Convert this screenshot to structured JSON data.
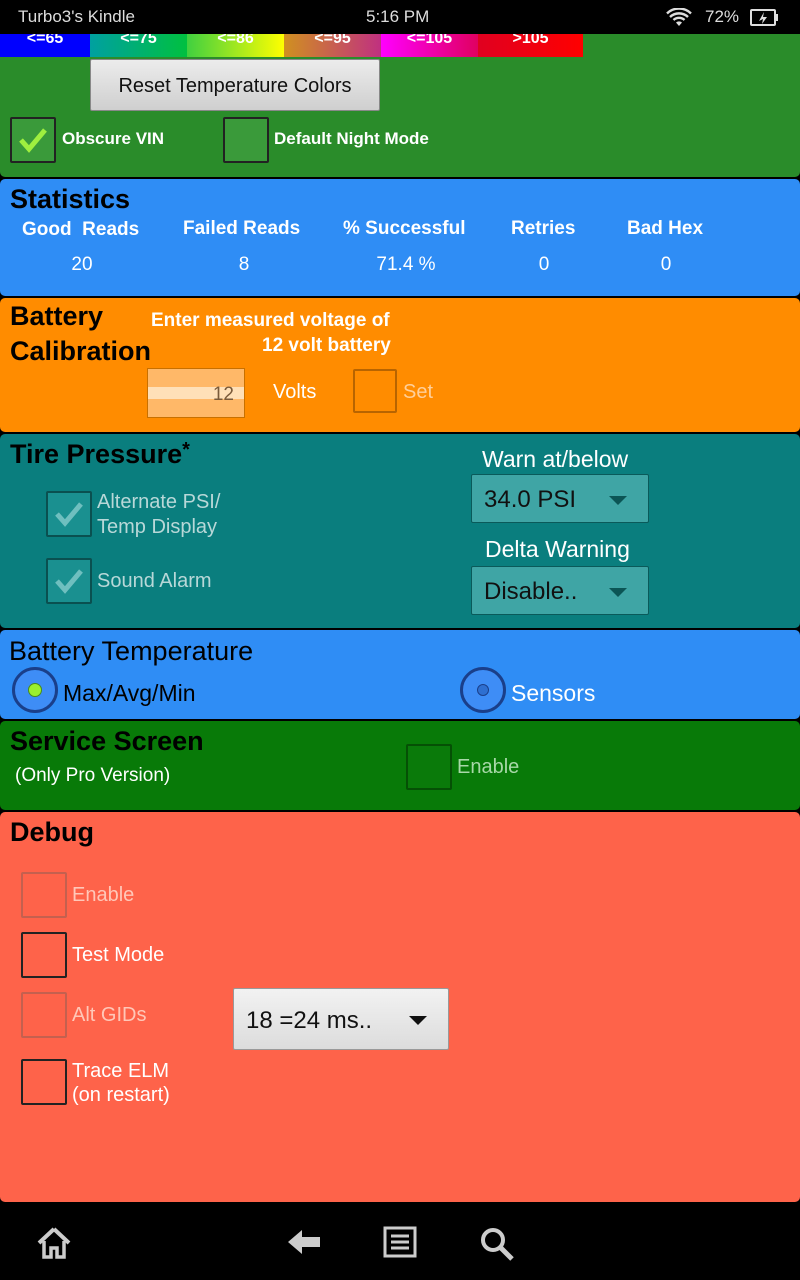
{
  "status_bar": {
    "device": "Turbo3's Kindle",
    "time": "5:16 PM",
    "battery": "72%"
  },
  "temp_legend": [
    "<=65",
    "<=75",
    "<=86",
    "<=95",
    "<=105",
    ">105"
  ],
  "general": {
    "reset_button": "Reset Temperature Colors",
    "obscure_vin": {
      "label": "Obscure VIN",
      "checked": true
    },
    "night_mode": {
      "label": "Default Night Mode",
      "checked": false
    }
  },
  "statistics": {
    "title": "Statistics",
    "headers": [
      "Good  Reads",
      "Failed Reads",
      "% Successful",
      "Retries",
      "Bad Hex"
    ],
    "values": [
      "20",
      "8",
      "71.4 %",
      "0",
      "0"
    ]
  },
  "battery_calibration": {
    "title_line1": "Battery",
    "title_line2": "Calibration",
    "prompt_line1": "Enter measured voltage of",
    "prompt_line2": "12 volt battery",
    "voltage_value": "12",
    "units": "Volts",
    "set_label": "Set"
  },
  "tire_pressure": {
    "title": "Tire Pressure",
    "asterisk": "*",
    "alt_display_line1": "Alternate PSI/",
    "alt_display_line2": "Temp Display",
    "sound_alarm": "Sound Alarm",
    "warn_label": "Warn at/below",
    "warn_value": "34.0 PSI",
    "delta_label": "Delta Warning",
    "delta_value": "Disable.."
  },
  "battery_temperature": {
    "title": "Battery Temperature",
    "options": [
      "Max/Avg/Min",
      "Sensors"
    ],
    "selected": "Max/Avg/Min"
  },
  "service_screen": {
    "title": "Service Screen",
    "subtitle": "(Only Pro Version)",
    "enable_label": "Enable"
  },
  "debug": {
    "title": "Debug",
    "enable": "Enable",
    "test_mode": "Test Mode",
    "alt_gids": "Alt GIDs",
    "trace_line1": "Trace ELM",
    "trace_line2": "(on restart)",
    "interval_value": "18 =24 ms.."
  },
  "colors": {
    "green": "#2a8c2a",
    "blue": "#2f8df5",
    "orange": "#ff8c00",
    "teal": "#0a7e7e",
    "dark_green": "#087a08",
    "salmon": "#fe634a"
  }
}
